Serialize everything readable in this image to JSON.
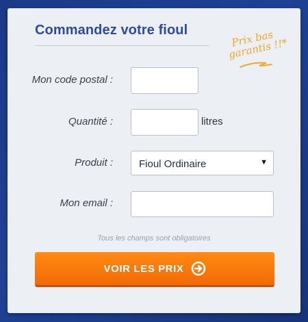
{
  "form": {
    "title": "Commandez votre fioul",
    "promo_line1": "Prix bas",
    "promo_line2": "garantis !!*",
    "postal_label": "Mon code postal :",
    "postal_value": "",
    "quantity_label": "Quantité :",
    "quantity_value": "",
    "quantity_unit": "litres",
    "product_label": "Produit :",
    "product_selected": "Fioul Ordinaire",
    "email_label": "Mon email :",
    "email_value": "",
    "required_note": "Tous les champs sont obligatoires",
    "submit_label": "VOIR LES PRIX"
  },
  "colors": {
    "background": "#1e4193",
    "card": "#eceff4",
    "title": "#2c4ba3",
    "promo": "#f4a62a",
    "cta": "#f47b0c"
  },
  "icons": {
    "submit": "arrow-right-circle-icon",
    "select": "caret-down-icon",
    "promo": "swoosh-underline-icon"
  }
}
